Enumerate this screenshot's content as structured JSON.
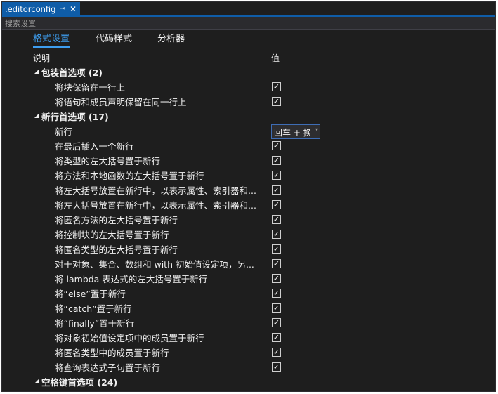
{
  "tab": {
    "title": ".editorconfig",
    "pin_icon": "⊸",
    "close_icon": "✕"
  },
  "search": {
    "placeholder": "搜索设置"
  },
  "subtabs": [
    {
      "label": "格式设置",
      "active": true
    },
    {
      "label": "代码样式",
      "active": false
    },
    {
      "label": "分析器",
      "active": false
    }
  ],
  "grid": {
    "col_desc": "说明",
    "col_value": "值"
  },
  "rows": [
    {
      "type": "group",
      "label": "包装首选项 (2)"
    },
    {
      "type": "item",
      "label": "将块保留在一行上",
      "value": "checked"
    },
    {
      "type": "item",
      "label": "将语句和成员声明保留在同一行上",
      "value": "checked"
    },
    {
      "type": "group",
      "label": "新行首选项 (17)"
    },
    {
      "type": "item",
      "label": "新行",
      "value": "combo",
      "combo_value": "回车 + 换"
    },
    {
      "type": "item",
      "label": "在最后插入一个新行",
      "value": "checked"
    },
    {
      "type": "item",
      "label": "将类型的左大括号置于新行",
      "value": "checked"
    },
    {
      "type": "item",
      "label": "将方法和本地函数的左大括号置于新行",
      "value": "checked"
    },
    {
      "type": "item",
      "label": "将左大括号放置在新行中，以表示属性、索引器和...",
      "value": "checked"
    },
    {
      "type": "item",
      "label": "将左大括号放置在新行中，以表示属性、索引器和...",
      "value": "checked"
    },
    {
      "type": "item",
      "label": "将匿名方法的左大括号置于新行",
      "value": "checked"
    },
    {
      "type": "item",
      "label": "将控制块的左大括号置于新行",
      "value": "checked"
    },
    {
      "type": "item",
      "label": "将匿名类型的左大括号置于新行",
      "value": "checked"
    },
    {
      "type": "item",
      "label": "对于对象、集合、数组和 with 初始值设定项，另...",
      "value": "checked"
    },
    {
      "type": "item",
      "label": "将 lambda 表达式的左大括号置于新行",
      "value": "checked"
    },
    {
      "type": "item",
      "label": "将“else”置于新行",
      "value": "checked"
    },
    {
      "type": "item",
      "label": "将“catch”置于新行",
      "value": "checked"
    },
    {
      "type": "item",
      "label": "将“finally”置于新行",
      "value": "checked"
    },
    {
      "type": "item",
      "label": "将对象初始值设定项中的成员置于新行",
      "value": "checked"
    },
    {
      "type": "item",
      "label": "将匿名类型中的成员置于新行",
      "value": "checked"
    },
    {
      "type": "item",
      "label": "将查询表达式子句置于新行",
      "value": "checked"
    },
    {
      "type": "group",
      "label": "空格键首选项 (24)"
    }
  ],
  "icons": {
    "collapse": "◢",
    "check": "✓",
    "dropdown": "▾"
  },
  "colors": {
    "accent": "#3e9ef0",
    "tab_active": "#0f5da8",
    "background": "#1e1e1e"
  }
}
